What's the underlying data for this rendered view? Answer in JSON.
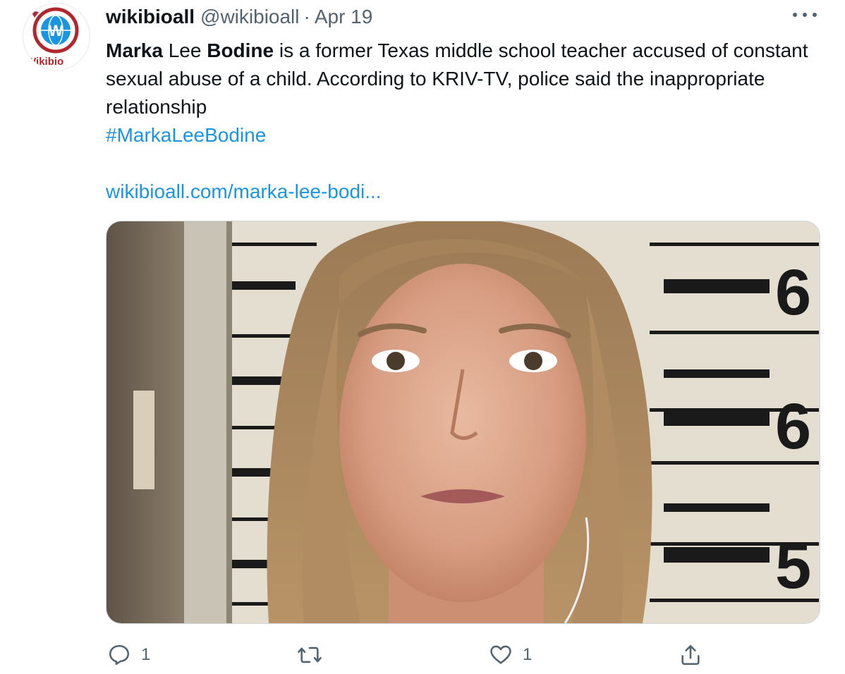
{
  "tweet": {
    "display_name": "wikibioall",
    "handle": "@wikibioall",
    "separator": "·",
    "date": "Apr 19",
    "avatar_text": "Wikibio",
    "text_bold_1": "Marka",
    "text_plain_1": " Lee ",
    "text_bold_2": "Bodine",
    "text_plain_2": " is a former Texas middle school teacher accused of constant sexual abuse of a child. According to KRIV-TV, police said the inappropriate relationship",
    "hashtag": "#MarkaLeeBodine",
    "url": "wikibioall.com/marka-lee-bodi..."
  },
  "media": {
    "description_icon": "mugshot-photo",
    "height_chart_labels": [
      "6",
      "6",
      "5"
    ]
  },
  "actions": {
    "reply_count": "1",
    "retweet_count": "",
    "like_count": "1"
  },
  "colors": {
    "link": "#1b95e0",
    "secondary_text": "#536471",
    "logo_red": "#b0272d",
    "logo_blue": "#1b95e0"
  }
}
